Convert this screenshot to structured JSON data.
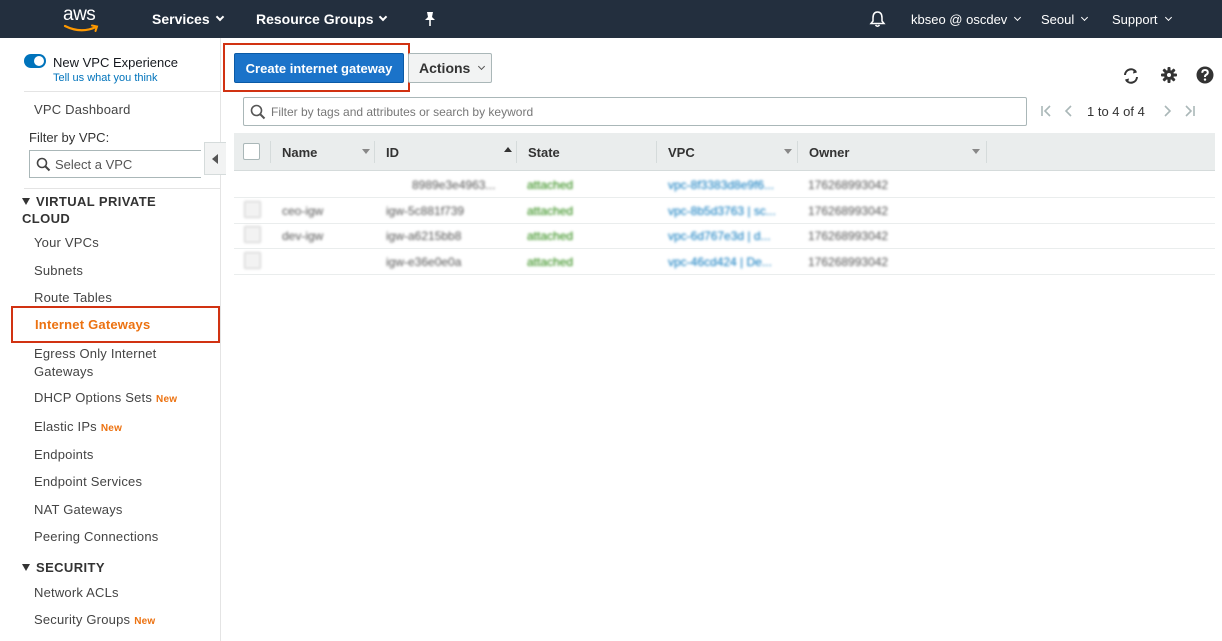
{
  "topnav": {
    "logo_text": "aws",
    "services": "Services",
    "resource_groups": "Resource Groups",
    "account": "kbseo @ oscdev",
    "region": "Seoul",
    "support": "Support"
  },
  "sidebar": {
    "vpc_experience": "New VPC Experience",
    "tell_us": "Tell us what you think",
    "dashboard": "VPC Dashboard",
    "filter_label": "Filter by VPC:",
    "select_placeholder": "Select a VPC",
    "section_vpc": "VIRTUAL PRIVATE CLOUD",
    "section_security": "SECURITY",
    "new_badge": "New",
    "items": [
      {
        "label": "Your VPCs",
        "new": false
      },
      {
        "label": "Subnets",
        "new": false
      },
      {
        "label": "Route Tables",
        "new": false
      },
      {
        "label": "Internet Gateways",
        "new": false,
        "active": true
      },
      {
        "label": "Egress Only Internet Gateways",
        "new": false
      },
      {
        "label": "DHCP Options Sets",
        "new": true
      },
      {
        "label": "Elastic IPs",
        "new": true
      },
      {
        "label": "Endpoints",
        "new": false
      },
      {
        "label": "Endpoint Services",
        "new": false
      },
      {
        "label": "NAT Gateways",
        "new": false
      },
      {
        "label": "Peering Connections",
        "new": false
      }
    ],
    "security_items": [
      {
        "label": "Network ACLs",
        "new": false
      },
      {
        "label": "Security Groups",
        "new": true
      }
    ]
  },
  "toolbar": {
    "create_label": "Create internet gateway",
    "actions_label": "Actions"
  },
  "search": {
    "placeholder": "Filter by tags and attributes or search by keyword"
  },
  "pagination": {
    "text": "1 to 4 of 4"
  },
  "table": {
    "columns": [
      "Name",
      "ID",
      "State",
      "VPC",
      "Owner"
    ],
    "rows": [
      {
        "name": "",
        "id": "8989e3e4963...",
        "state": "attached",
        "vpc": "vpc-8f3383d8e9f6...",
        "owner": "176268993042"
      },
      {
        "name": "ceo-igw",
        "id": "igw-5c881f739",
        "state": "attached",
        "vpc": "vpc-8b5d3763 | sc...",
        "owner": "176268993042"
      },
      {
        "name": "dev-igw",
        "id": "igw-a6215bb8",
        "state": "attached",
        "vpc": "vpc-6d767e3d | d...",
        "owner": "176268993042"
      },
      {
        "name": "",
        "id": "igw-e36e0e0a",
        "state": "attached",
        "vpc": "vpc-46cd424 | De...",
        "owner": "176268993042"
      }
    ]
  },
  "colors": {
    "nav_bg": "#232f3e",
    "primary": "#1b73c9",
    "active": "#ec7211",
    "highlight": "#d13212"
  }
}
